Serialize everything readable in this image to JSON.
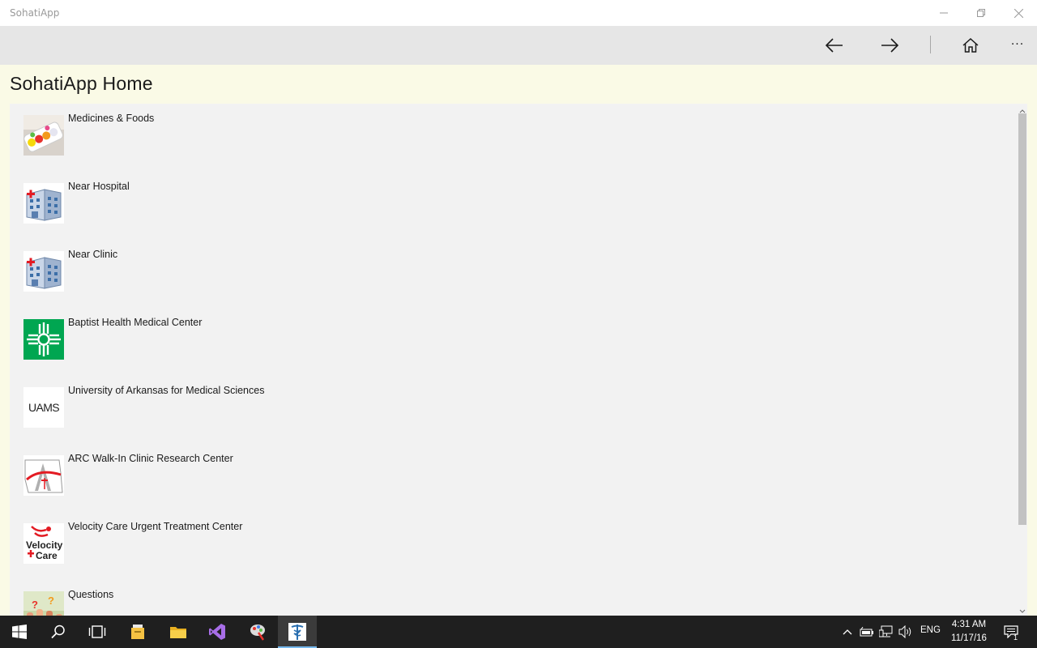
{
  "window": {
    "title": "SohatiApp",
    "controls": [
      "minimize-icon",
      "restore-icon",
      "close-icon"
    ]
  },
  "appbar": {
    "buttons": [
      "back-arrow-icon",
      "forward-arrow-icon",
      "home-icon",
      "more-ellipsis-icon"
    ],
    "more_label": "···"
  },
  "page": {
    "title": "SohatiApp Home"
  },
  "list": {
    "items": [
      {
        "label": "Medicines & Foods",
        "icon": "pills-thumbnail"
      },
      {
        "label": "Near Hospital",
        "icon": "hospital-building-thumbnail"
      },
      {
        "label": "Near Clinic",
        "icon": "clinic-building-thumbnail"
      },
      {
        "label": "Baptist Health Medical Center",
        "icon": "baptist-health-logo"
      },
      {
        "label": "University of Arkansas for Medical Sciences",
        "icon": "uams-logo"
      },
      {
        "label": "ARC Walk-In Clinic Research Center",
        "icon": "arc-logo"
      },
      {
        "label": "Velocity Care Urgent Treatment Center",
        "icon": "velocity-care-logo"
      },
      {
        "label": "Questions",
        "icon": "questions-thumbnail"
      }
    ],
    "uams_text": "UAMS"
  },
  "taskbar": {
    "apps": [
      "start-icon",
      "search-icon",
      "task-view-icon",
      "file-manager-icon",
      "folder-icon",
      "visual-studio-icon",
      "paint-icon",
      "sohati-app-icon"
    ],
    "tray": {
      "language": "ENG",
      "time": "4:31 AM",
      "date": "11/17/16",
      "notifications": "1"
    }
  },
  "colors": {
    "title_bar": "#ffffff",
    "app_bar": "#e6e6e6",
    "page_bg": "#fafae6",
    "list_bg": "#f2f2f2",
    "taskbar": "#1f1f1f",
    "accent": "#76b9ed",
    "baptist_green": "#00a651",
    "medical_red": "#e31b23"
  }
}
